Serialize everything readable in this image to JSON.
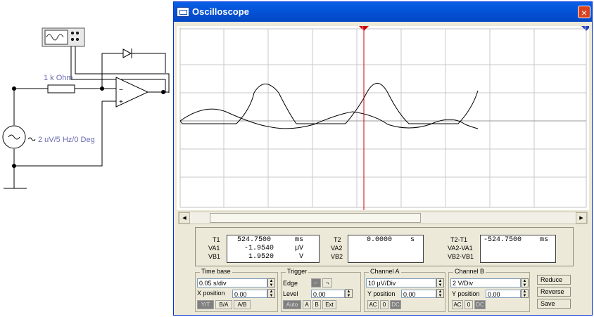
{
  "window": {
    "title": "Oscilloscope",
    "close_label": "×"
  },
  "circuit": {
    "resistor_label": "1 k Ohm",
    "source_label": "2 uV/5 Hz/0 Deg"
  },
  "markers": {
    "t1": "1",
    "t2": "2"
  },
  "readouts": {
    "t1": {
      "label": "T1",
      "value": "524.7500",
      "unit": "ms"
    },
    "va1": {
      "label": "VA1",
      "value": "-1.9540",
      "unit": "µV"
    },
    "vb1": {
      "label": "VB1",
      "value": "1.9520",
      "unit": "V"
    },
    "t2": {
      "label": "T2",
      "value": "0.0000",
      "unit": "s"
    },
    "va2": {
      "label": "VA2"
    },
    "vb2": {
      "label": "VB2"
    },
    "t2t1": {
      "label": "T2-T1",
      "value": "-524.7500",
      "unit": "ms"
    },
    "va2va1": {
      "label": "VA2-VA1"
    },
    "vb2vb1": {
      "label": "VB2-VB1"
    }
  },
  "timebase": {
    "title": "Time base",
    "value": "0.05 s/div",
    "xpos_label": "X position",
    "xpos_value": "0.00",
    "modes": [
      "Y/T",
      "B/A",
      "A/B"
    ]
  },
  "trigger": {
    "title": "Trigger",
    "edge_label": "Edge",
    "level_label": "Level",
    "level_value": "0.00",
    "modes": [
      "Auto",
      "A",
      "B",
      "Ext"
    ]
  },
  "channel_a": {
    "title": "Channel A",
    "value": "10 µV/Div",
    "ypos_label": "Y position",
    "ypos_value": "0.00",
    "coupling": [
      "AC",
      "0",
      "DC"
    ]
  },
  "channel_b": {
    "title": "Channel B",
    "value": "2 V/Div",
    "ypos_label": "Y position",
    "ypos_value": "0.00",
    "coupling": [
      "AC",
      "0",
      "DC"
    ]
  },
  "buttons": {
    "reduce": "Reduce",
    "reverse": "Reverse",
    "save": "Save"
  }
}
